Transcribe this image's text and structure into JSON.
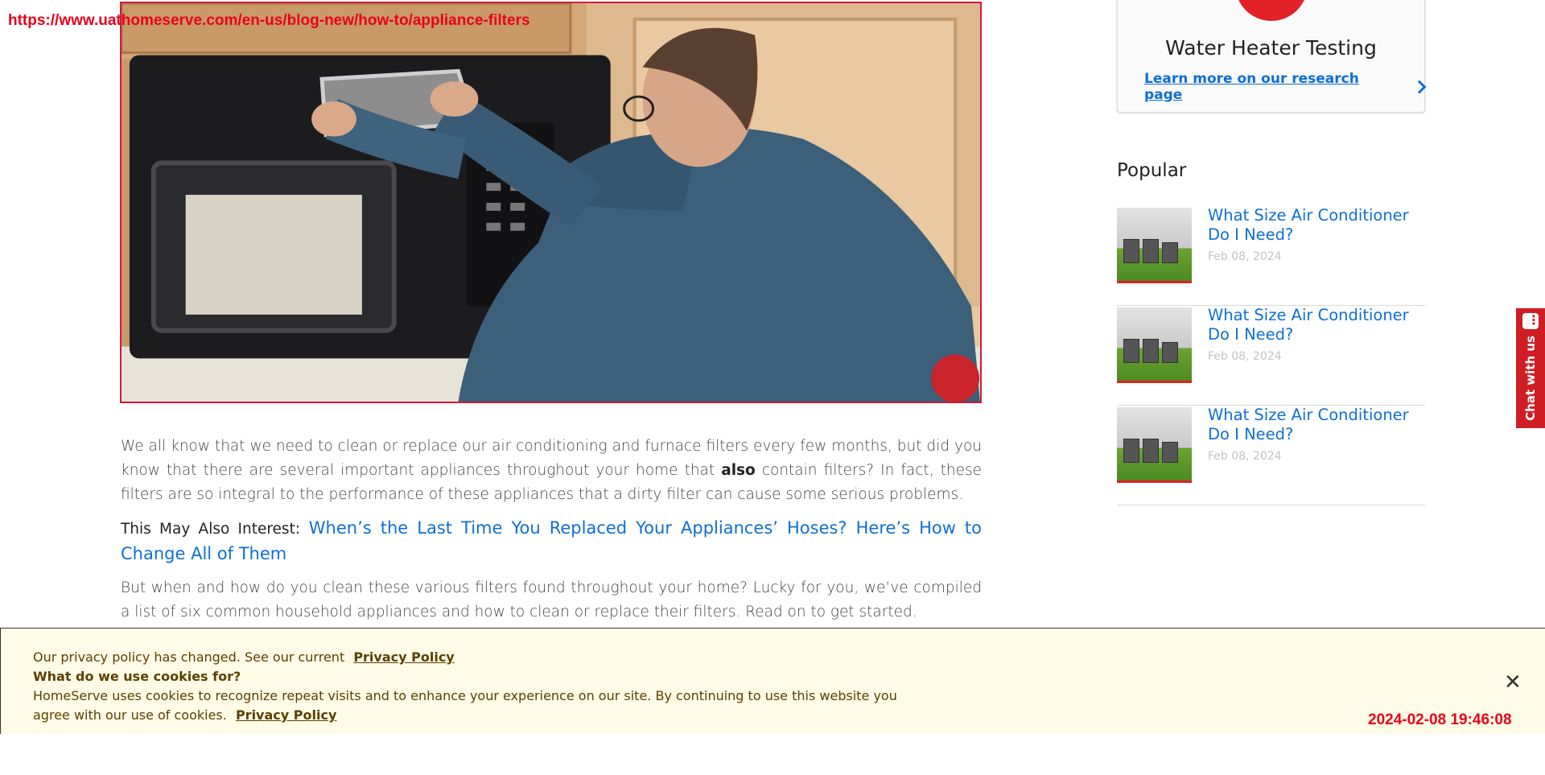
{
  "url_overlay": "https://www.uathomeserve.com/en-us/blog-new/how-to/appliance-filters",
  "timestamp_overlay": "2024-02-08 19:46:08",
  "article": {
    "p1_before": "We all know that we need to clean or replace our air conditioning and furnace filters every few months, but did you know that there are several important appliances throughout your home that ",
    "p1_bold": "also",
    "p1_after": " contain filters? In fact, these filters are so integral to the performance of these appliances that a dirty filter can cause some serious problems.",
    "interest_label": "This May Also Interest:",
    "interest_link": "When’s the Last Time You Replaced Your Appliances’ Hoses? Here’s How to Change All of Them",
    "p2": "But when and how do you clean these various filters found throughout your home? Lucky for you, we’ve compiled a list of six common household appliances and how to clean or replace their filters. Read on to get started."
  },
  "sidebar": {
    "card": {
      "title": "Water Heater Testing",
      "link": "Learn more on our research page",
      "accent": "#e32228"
    },
    "popular_title": "Popular",
    "popular": [
      {
        "title": "What Size Air Conditioner Do I Need?",
        "date": "Feb 08, 2024"
      },
      {
        "title": "What Size Air Conditioner Do I Need?",
        "date": "Feb 08, 2024"
      },
      {
        "title": "What Size Air Conditioner Do I Need?",
        "date": "Feb 08, 2024"
      }
    ]
  },
  "chat": {
    "label": "Chat with us",
    "color": "#d01d24"
  },
  "cookie": {
    "line1": "Our privacy policy has changed. See our current",
    "line1_link": "Privacy Policy",
    "line2": "What do we use cookies for?",
    "line3": "HomeServe uses cookies to recognize repeat visits and to enhance your experience on our site. By continuing to use this website you",
    "line4": "agree with our use of cookies.",
    "line4_link": "Privacy Policy",
    "close": "✕",
    "background": "#fefbe6"
  },
  "colors": {
    "link": "#0d6fd6",
    "brand_red": "#e32228"
  }
}
